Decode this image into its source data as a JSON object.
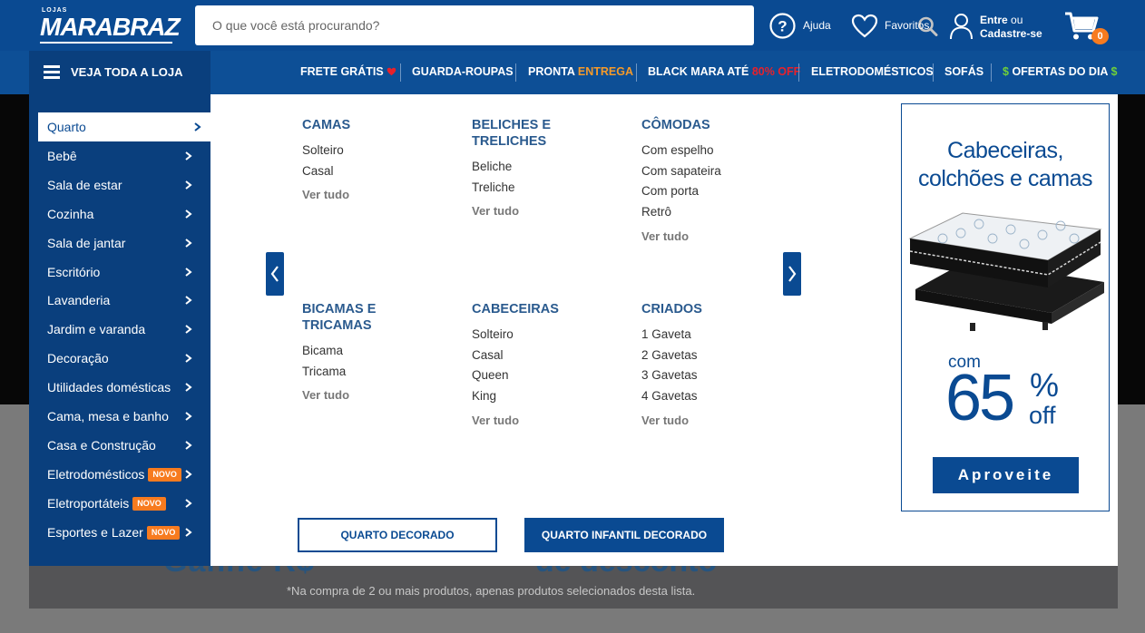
{
  "brand": {
    "small": "LOJAS",
    "name": "MARABRAZ"
  },
  "search": {
    "placeholder": "O que você está procurando?"
  },
  "header": {
    "help_label": "Ajuda",
    "favorites_label": "Favoritos",
    "login_line1": "Entre",
    "login_or": "ou",
    "login_line2": "Cadastre-se",
    "cart_count": "0"
  },
  "nav": {
    "all_store": "VEJA TODA A LOJA",
    "frete": "FRETE GRÁTIS",
    "guarda": "GUARDA-ROUPAS",
    "pronta_1": "PRONTA",
    "pronta_2": "ENTREGA",
    "black_1": "BLACK MARA ATÉ",
    "black_2": "80% OFF",
    "eletro": "ELETRODOMÉSTICOS",
    "sofas": "SOFÁS",
    "ofertas": "OFERTAS DO DIA"
  },
  "sidebar": {
    "novo_label": "NOVO",
    "items": [
      {
        "label": "Quarto"
      },
      {
        "label": "Bebê"
      },
      {
        "label": "Sala de estar"
      },
      {
        "label": "Cozinha"
      },
      {
        "label": "Sala de jantar"
      },
      {
        "label": "Escritório"
      },
      {
        "label": "Lavanderia"
      },
      {
        "label": "Jardim e varanda"
      },
      {
        "label": "Decoração"
      },
      {
        "label": "Utilidades domésticas"
      },
      {
        "label": "Cama, mesa e banho"
      },
      {
        "label": "Casa e Construção"
      },
      {
        "label": "Eletrodomésticos"
      },
      {
        "label": "Eletroportáteis"
      },
      {
        "label": "Esportes e Lazer"
      }
    ]
  },
  "menu": {
    "ver_tudo": "Ver tudo",
    "groups": [
      {
        "title": "CAMAS",
        "links": [
          "Solteiro",
          "Casal"
        ]
      },
      {
        "title": "BELICHES E TRELICHES",
        "links": [
          "Beliche",
          "Treliche"
        ]
      },
      {
        "title": "CÔMODAS",
        "links": [
          "Com espelho",
          "Com sapateira",
          "Com porta",
          "Retrô"
        ]
      },
      {
        "title": "BICAMAS E TRICAMAS",
        "links": [
          "Bicama",
          "Tricama"
        ]
      },
      {
        "title": "CABECEIRAS",
        "links": [
          "Solteiro",
          "Casal",
          "Queen",
          "King"
        ]
      },
      {
        "title": "CRIADOS",
        "links": [
          "1 Gaveta",
          "2 Gavetas",
          "3 Gavetas",
          "4 Gavetas"
        ]
      }
    ],
    "btn_decorado": "QUARTO DECORADO",
    "btn_infantil": "QUARTO INFANTIL DECORADO"
  },
  "promo": {
    "title_1": "Cabeceiras,",
    "title_2": "colchões e camas",
    "com": "com",
    "number": "65",
    "percent": "%",
    "off": "off",
    "button": "Aproveite"
  },
  "background": {
    "partial_1": "Ganhe",
    "partial_2": "R$",
    "partial_3": "de desconto",
    "footnote": "*Na compra de 2 ou mais produtos, apenas produtos selecionados desta lista."
  },
  "colors": {
    "primary": "#0a4a92",
    "accent": "#f77b1f",
    "heart": "#e8212b",
    "dollar": "#6fcf3a"
  }
}
